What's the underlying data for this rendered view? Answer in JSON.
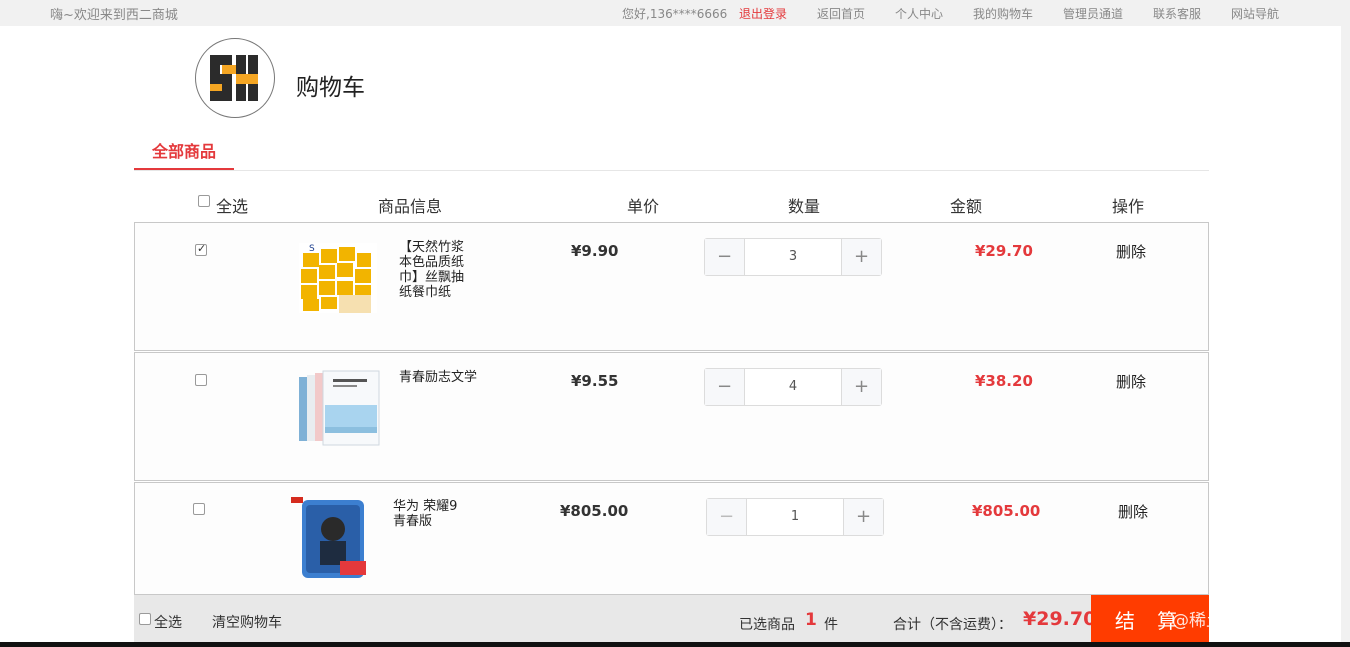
{
  "topbar": {
    "welcome": "嗨~欢迎来到西二商城",
    "greeting": "您好,136****6666",
    "logout": "退出登录",
    "home": "返回首页",
    "personal": "个人中心",
    "my_cart": "我的购物车",
    "admin": "管理员通道",
    "service": "联系客服",
    "nav": "网站导航"
  },
  "header": {
    "title": "购物车"
  },
  "tabs": {
    "all": "全部商品"
  },
  "table_headers": {
    "select_all": "全选",
    "info": "商品信息",
    "unit_price": "单价",
    "quantity": "数量",
    "amount": "金额",
    "action": "操作"
  },
  "items": [
    {
      "name": "【天然竹浆本色品质纸巾】丝飘抽纸餐巾纸",
      "price": "¥9.90",
      "qty": "3",
      "amount": "¥29.70",
      "delete": "删除",
      "checked": true
    },
    {
      "name": "青春励志文学",
      "price": "¥9.55",
      "qty": "4",
      "amount": "¥38.20",
      "delete": "删除",
      "checked": false
    },
    {
      "name": "华为 荣耀9青春版",
      "price": "¥805.00",
      "qty": "1",
      "amount": "¥805.00",
      "delete": "删除",
      "checked": false
    }
  ],
  "footer": {
    "select_all": "全选",
    "clear": "清空购物车",
    "selected_label": "已选商品",
    "selected_count": "1",
    "unit": "件",
    "total_label": "合计（不含运费）：",
    "total": "¥29.70",
    "checkout": "结 算"
  },
  "watermark": "@稀土掘金技术社区",
  "colors": {
    "accent": "#e4393c",
    "checkout": "#ff3c00"
  }
}
